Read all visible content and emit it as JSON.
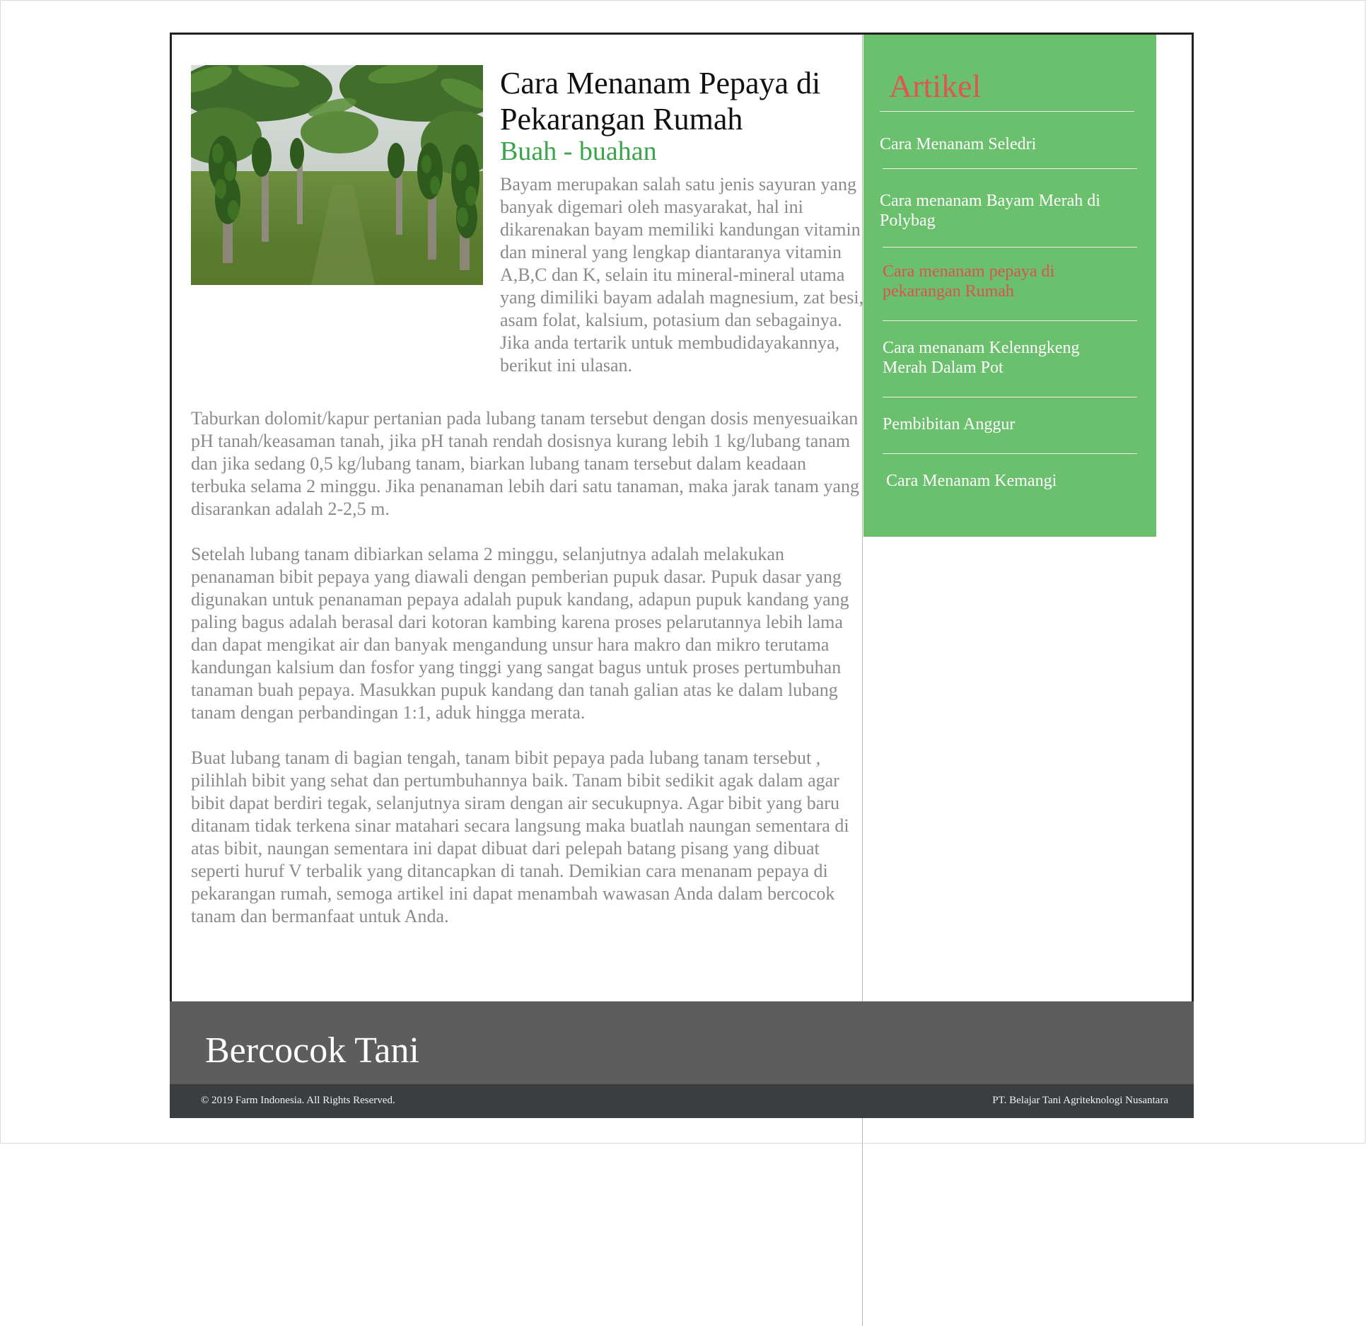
{
  "article": {
    "title": "Cara Menanam Pepaya di Pekarangan Rumah",
    "category": "Buah - buahan",
    "intro": "Bayam merupakan salah satu jenis sayuran yang banyak digemari oleh masyarakat, hal ini dikarenakan bayam memiliki kandungan vitamin dan mineral yang lengkap diantaranya vitamin A,B,C dan K, selain itu mineral-mineral utama yang dimiliki bayam adalah magnesium, zat besi, asam folat, kalsium, potasium dan sebagainya. Jika anda tertarik untuk membudidayakannya, berikut ini ulasan.",
    "paragraphs": [
      "Taburkan dolomit/kapur pertanian pada lubang tanam tersebut dengan dosis menyesuaikan pH tanah/keasaman tanah, jika pH tanah rendah dosisnya kurang lebih 1 kg/lubang tanam dan jika sedang 0,5 kg/lubang tanam, biarkan lubang tanam tersebut dalam keadaan terbuka selama 2 minggu. Jika penanaman lebih dari satu tanaman, maka jarak tanam yang disarankan adalah 2-2,5 m.",
      "Setelah lubang tanam dibiarkan selama 2 minggu, selanjutnya adalah melakukan penanaman bibit pepaya yang diawali dengan pemberian pupuk dasar. Pupuk dasar yang digunakan untuk penanaman pepaya adalah pupuk kandang, adapun pupuk kandang yang paling bagus adalah berasal dari kotoran kambing karena proses pelarutannya lebih lama dan dapat mengikat air dan banyak mengandung unsur hara makro dan mikro terutama kandungan kalsium dan fosfor yang tinggi yang sangat bagus untuk proses pertumbuhan tanaman buah pepaya. Masukkan pupuk kandang dan tanah galian atas ke dalam lubang tanam dengan perbandingan 1:1, aduk hingga merata.",
      "Buat lubang tanam di bagian tengah, tanam bibit pepaya pada lubang tanam tersebut , pilihlah bibit yang sehat dan pertumbuhannya baik. Tanam bibit sedikit agak dalam agar bibit dapat berdiri tegak, selanjutnya siram dengan air secukupnya. Agar bibit yang baru ditanam tidak terkena sinar matahari secara langsung maka buatlah naungan sementara di atas bibit, naungan sementara ini dapat dibuat dari pelepah batang pisang yang dibuat seperti huruf V terbalik yang ditancapkan di tanah. Demikian cara menanam pepaya di pekarangan rumah, semoga artikel ini dapat menambah wawasan Anda dalam bercocok tanam dan bermanfaat untuk Anda."
    ]
  },
  "sidebar": {
    "title": "Artikel",
    "items": [
      {
        "label": "Cara Menanam Seledri"
      },
      {
        "label": "Cara menanam Bayam Merah di Polybag"
      },
      {
        "label": "Cara menanam pepaya di pekarangan Rumah",
        "active": true
      },
      {
        "label": "Cara menanam Kelenngkeng Merah Dalam Pot"
      },
      {
        "label": "Pembibitan Anggur"
      },
      {
        "label": "Cara Menanam Kemangi"
      }
    ]
  },
  "footer": {
    "brand": "Bercocok Tani",
    "copyright": "© 2019 Farm Indonesia. All Rights Reserved.",
    "company": "PT. Belajar Tani Agriteknologi Nusantara"
  },
  "colors": {
    "sidebar_bg": "#6bc06d",
    "accent_red": "#e05452",
    "category_green": "#3aa449",
    "footer_band": "#5d5d5d",
    "footer_bar": "#3a3e40"
  }
}
